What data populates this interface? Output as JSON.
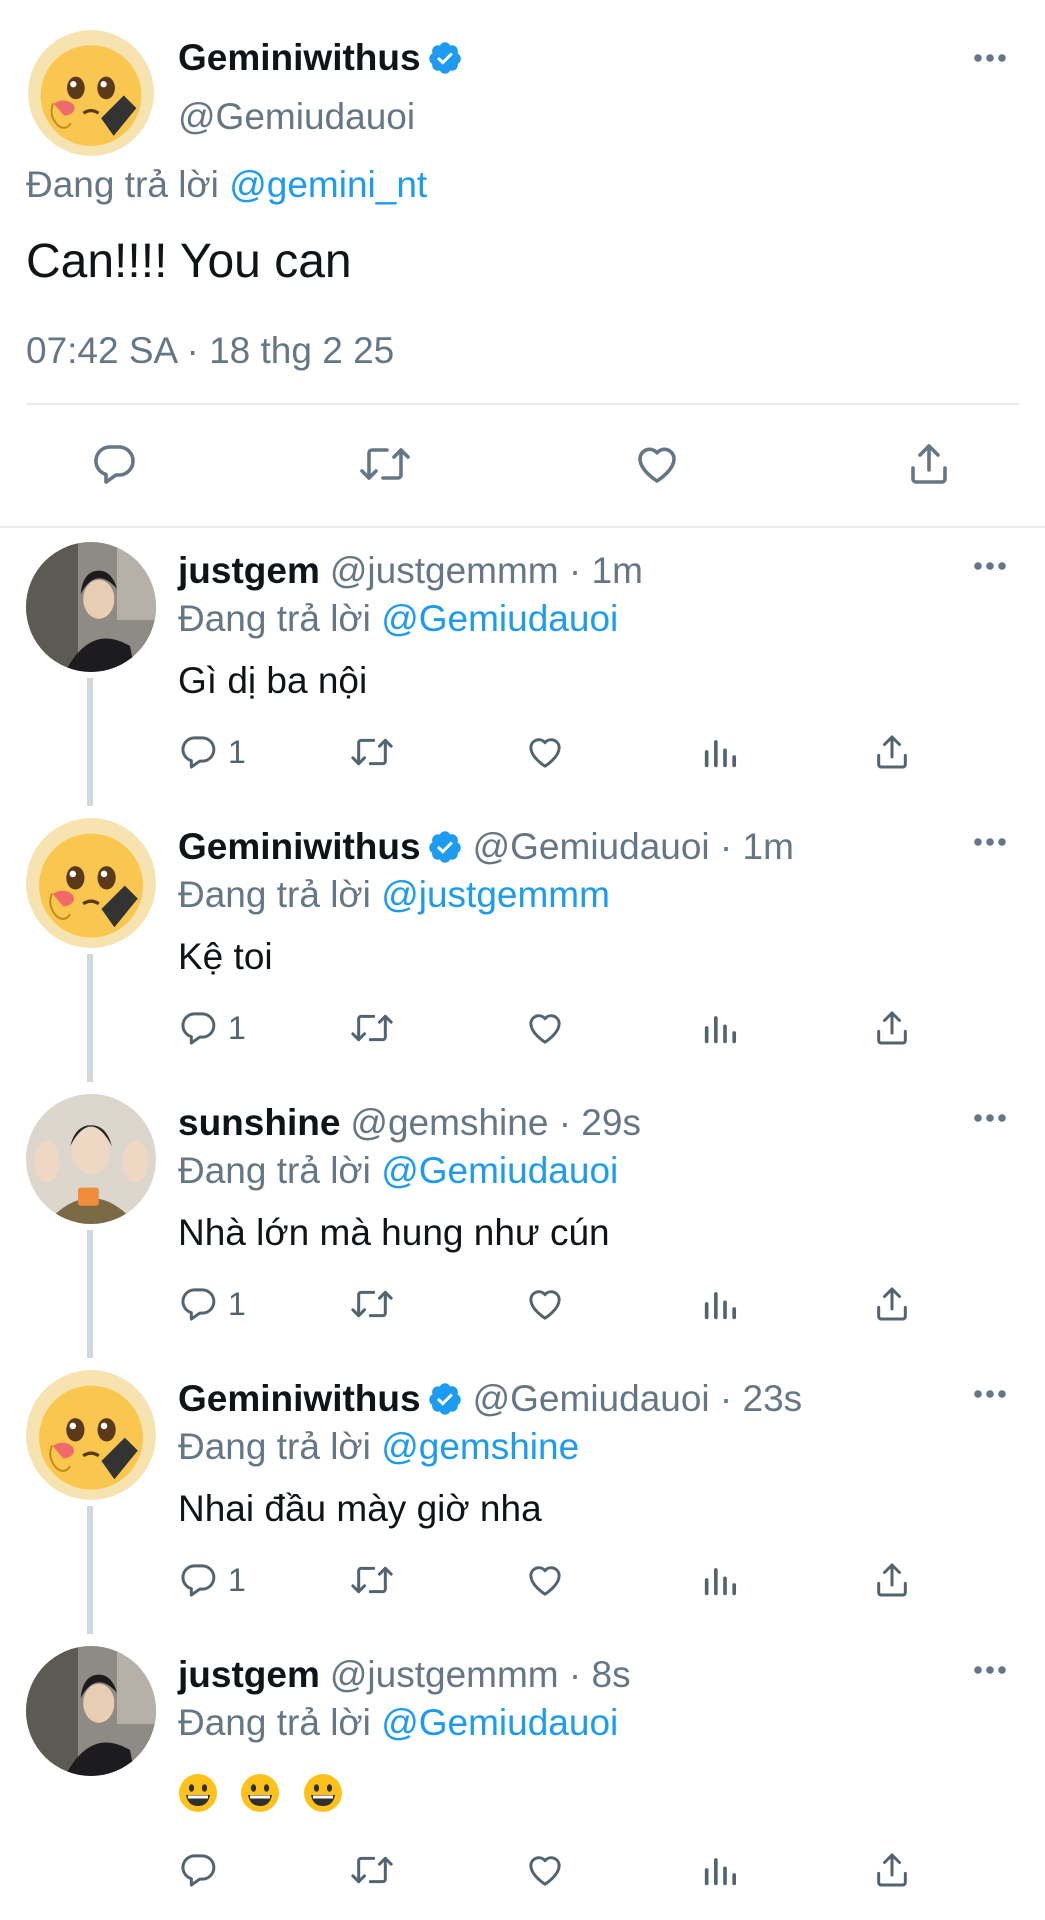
{
  "main_tweet": {
    "author_name": "Geminiwithus",
    "handle": "@Gemiudauoi",
    "replying_label": "Đang trả lời",
    "replying_to": "@gemini_nt",
    "text": "Can!!!! You can",
    "timestamp": "07:42 SA · 18 thg 2 25",
    "actions": [
      "reply-icon",
      "retweet-icon",
      "like-icon",
      "share-icon"
    ]
  },
  "replies": [
    {
      "name": "justgem",
      "meta": "@justgemmm · 1m",
      "replying_label": "Đang trả lời",
      "replying_to": "@Gemiudauoi",
      "text": "Gì dị ba nội",
      "reply_count": "1",
      "verified": false,
      "avatar": "person-photo"
    },
    {
      "name": "Geminiwithus",
      "meta": "@Gemiudauoi · 1m",
      "replying_label": "Đang trả lời",
      "replying_to": "@justgemmm",
      "text": "Kệ toi",
      "reply_count": "1",
      "verified": true,
      "avatar": "pleading-face-emoji"
    },
    {
      "name": "sunshine",
      "meta": "@gemshine · 29s",
      "replying_label": "Đang trả lời",
      "replying_to": "@Gemiudauoi",
      "text": "Nhà lớn mà hung như cún",
      "reply_count": "1",
      "verified": false,
      "avatar": "person-waving-photo"
    },
    {
      "name": "Geminiwithus",
      "meta": "@Gemiudauoi · 23s",
      "replying_label": "Đang trả lời",
      "replying_to": "@gemshine",
      "text": "Nhai đầu mày giờ nha",
      "reply_count": "1",
      "verified": true,
      "avatar": "pleading-face-emoji"
    },
    {
      "name": "justgem",
      "meta": "@justgemmm · 8s",
      "replying_label": "Đang trả lời",
      "replying_to": "@Gemiudauoi",
      "text": "😀😀😀",
      "reply_count": "",
      "verified": false,
      "avatar": "person-photo"
    }
  ],
  "colors": {
    "link": "#1d9bf0",
    "secondary_text": "#657786",
    "primary_text": "#0f1419",
    "divider": "#e6ecf0",
    "thread_line": "#cfd9de"
  }
}
